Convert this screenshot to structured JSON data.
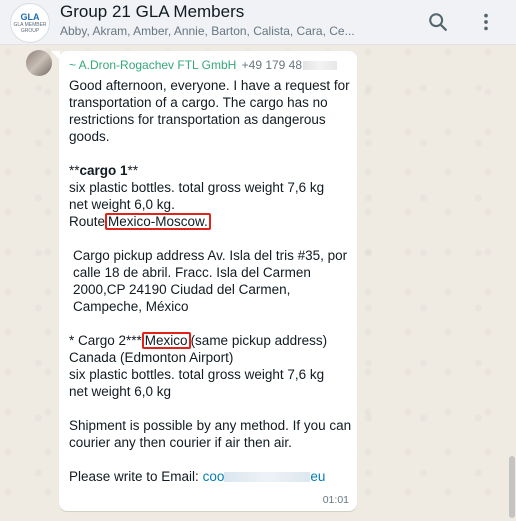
{
  "header": {
    "title": "Group 21 GLA Members",
    "members": "Abby, Akram, Amber, Annie, Barton, Calista, Cara, Ce...",
    "avatar_top": "GLA",
    "avatar_bottom": "GLA MEMBER GROUP",
    "search_icon": "search-icon",
    "menu_icon": "more-vertical-icon"
  },
  "message": {
    "sender_name": "~ A.Dron-Rogachev FTL GmbH",
    "sender_phone": "+49 179 48",
    "intro": "Good afternoon, everyone. I have a request for transportation of a cargo. The cargo has no restrictions for transportation as dangerous goods.",
    "cargo1_heading_prefix": "**",
    "cargo1_heading": "cargo 1",
    "cargo1_heading_suffix": "**",
    "cargo1_line1": "six plastic bottles. total gross weight 7,6 kg",
    "cargo1_line2": "net weight 6,0 kg.",
    "route_label": "Route",
    "route_value": " Mexico-Moscow.",
    "pickup": "Cargo pickup address Av. Isla del tris #35, por calle 18 de abril. Fracc. Isla del Carmen 2000,CP 24190 Ciudad del Carmen, Campeche, México",
    "cargo2_prefix": "* Cargo 2***",
    "cargo2_highlight": "Mexico",
    "cargo2_suffix": "(same pickup address)",
    "cargo2_dest": "Canada (Edmonton Airport)",
    "cargo2_line1": "six plastic bottles. total gross weight 7,6 kg",
    "cargo2_line2": "net weight 6,0 kg",
    "shipment": "Shipment is possible by any method. If you can courier any then courier if air then air.",
    "email_label": "Please write to Email: ",
    "email_start": "coo",
    "email_end": "eu",
    "time": "01:01"
  },
  "colors": {
    "highlight_box": "#e2231a",
    "sender_name": "#35a87a",
    "link": "#027eb5",
    "chat_background": "#efeae2"
  }
}
